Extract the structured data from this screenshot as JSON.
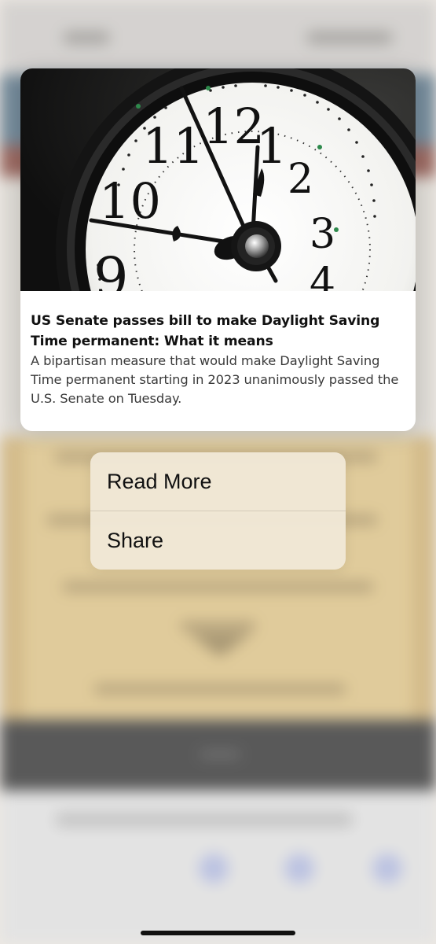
{
  "preview_card": {
    "title": "US Senate passes bill to make Daylight Saving Time permanent: What it means",
    "description": "A bipartisan measure that would make Daylight Saving Time permanent starting in 2023 unanimously passed the U.S. Senate on Tuesday.",
    "clock_numerals": {
      "n12": "12",
      "n11": "11",
      "n1": "1",
      "n10": "10",
      "n2": "2",
      "n3": "3",
      "n9": "9",
      "n4": "4"
    }
  },
  "context_menu": {
    "items": [
      {
        "label": "Read More"
      },
      {
        "label": "Share"
      }
    ]
  },
  "colors": {
    "menu_background": "#f0e8d6",
    "card_background": "#ffffff",
    "accent_band": "#4e6a7e"
  }
}
